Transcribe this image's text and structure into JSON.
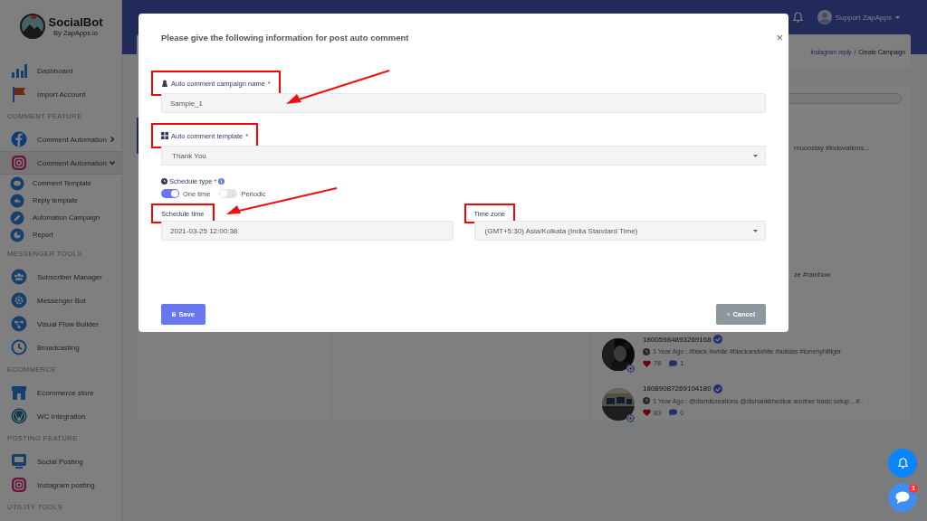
{
  "sidebar": {
    "logo": {
      "name": "SocialBot",
      "tagline": "By ZapApps.io"
    },
    "sections": [
      {
        "items": [
          {
            "label": "Dashboard",
            "selected": false
          },
          {
            "label": "Import Account",
            "selected": false
          }
        ]
      },
      {
        "heading": "COMMENT FEATURE",
        "items": [
          {
            "label": "Comment Automation",
            "selected": false,
            "expanded": false
          },
          {
            "label": "Comment Automation",
            "selected": true,
            "expanded": true,
            "children": [
              {
                "label": "Comment Template"
              },
              {
                "label": "Reply template"
              },
              {
                "label": "Automation Campaign"
              },
              {
                "label": "Report"
              }
            ]
          }
        ]
      },
      {
        "heading": "MESSENGER TOOLS",
        "items": [
          {
            "label": "Subscriber Manager",
            "selected": false
          },
          {
            "label": "Messenger Bot",
            "selected": false
          },
          {
            "label": "Visual Flow Builder",
            "selected": false
          },
          {
            "label": "Broadcasting",
            "selected": false
          }
        ]
      },
      {
        "heading": "ECOMMERCE",
        "items": [
          {
            "label": "Ecommerce store",
            "selected": false
          },
          {
            "label": "WC Integration",
            "selected": false
          }
        ]
      },
      {
        "heading": "POSTING FEATURE",
        "items": [
          {
            "label": "Social Posting",
            "selected": false
          },
          {
            "label": "Instagram posting",
            "selected": false
          }
        ]
      },
      {
        "heading": "UTILITY TOOLS"
      }
    ]
  },
  "topbar": {
    "user": "Support ZapApps"
  },
  "breadcrumb": [
    {
      "label": "Instagram reply",
      "kind": "link"
    },
    {
      "label": "/",
      "kind": "separator"
    },
    {
      "label": "Create Campaign",
      "kind": "current"
    }
  ],
  "posts_panel": {
    "fragments": [
      "rnoonstay #indovations...",
      "ze #rainbow"
    ],
    "posts": [
      {
        "id": "18005984893269168",
        "meta": "1 Year Ago : #black #white #blackandwhite #adidas #tommyhilfiger",
        "likes": "78",
        "comments": "1"
      },
      {
        "id": "18089087269104180",
        "meta": "1 Year Ago : @dismitcreations @dishankkhedkar another basic setup .. #..",
        "likes": "83",
        "comments": "0"
      }
    ]
  },
  "modal": {
    "title": "Please give the following information for post auto comment",
    "close": "×",
    "fields": [
      {
        "kind": "text",
        "label": "Auto comment campaign name",
        "required_mark": "*",
        "highlighted": true,
        "value": "Sample_1"
      },
      {
        "kind": "select",
        "label": "Auto comment template",
        "required_mark": "*",
        "highlighted": true,
        "value": "Thank You"
      }
    ],
    "schedule_type": {
      "label": "Schedule type",
      "required_mark": "*",
      "options": [
        {
          "label": "One time",
          "selected": true
        },
        {
          "label": "Periodic",
          "selected": false
        }
      ]
    },
    "row_fields": [
      {
        "kind": "text",
        "label": "Schedule time",
        "highlighted": true,
        "value": "2021-03-25 12:00:38"
      },
      {
        "kind": "select",
        "label": "Time zone",
        "highlighted": true,
        "value": "(GMT+5:30) Asia/Kolkata (India Standard Time)"
      }
    ],
    "buttons": [
      {
        "label": "Save",
        "kind": "primary"
      },
      {
        "label": "Cancel",
        "kind": "secondary"
      }
    ]
  },
  "floating": {
    "chat_badge": "1"
  }
}
